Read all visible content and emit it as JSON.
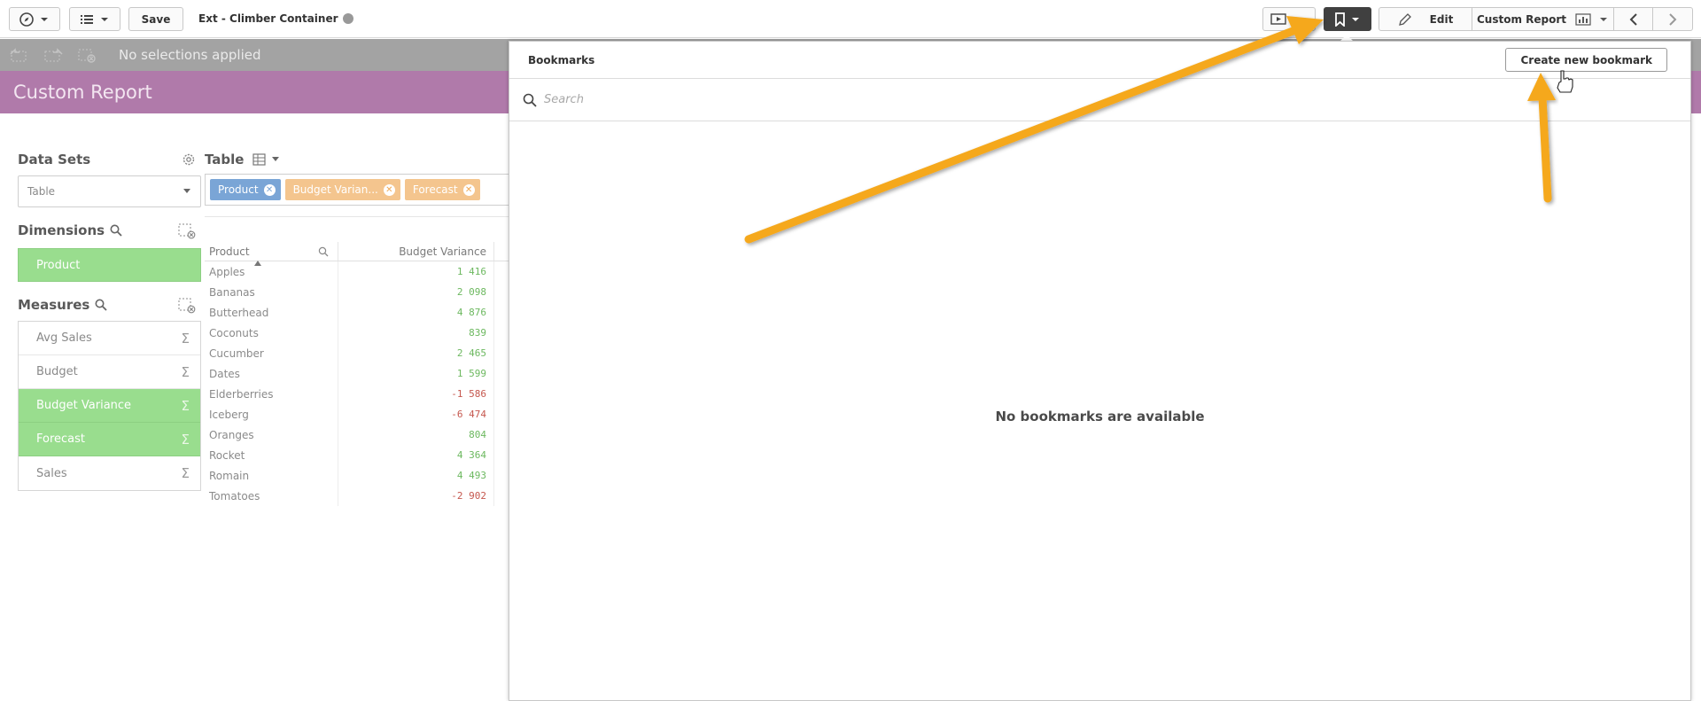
{
  "toolbar": {
    "save_label": "Save",
    "app_title": "Ext - Climber Container",
    "edit_label": "Edit",
    "sheet_label": "Custom Report"
  },
  "selections": {
    "status": "No selections applied"
  },
  "sheet": {
    "title": "Custom Report"
  },
  "left_panel": {
    "data_sets_label": "Data Sets",
    "data_set_selected": "Table",
    "dimensions_label": "Dimensions",
    "dimensions": [
      "Product"
    ],
    "measures_label": "Measures",
    "measures": [
      {
        "label": "Avg Sales",
        "selected": false
      },
      {
        "label": "Budget",
        "selected": false
      },
      {
        "label": "Budget Variance",
        "selected": true
      },
      {
        "label": "Forecast",
        "selected": true
      },
      {
        "label": "Sales",
        "selected": false
      }
    ],
    "sigma": "Σ"
  },
  "table_panel": {
    "title": "Table",
    "chips": [
      {
        "label": "Product",
        "color": "#7aa5d6"
      },
      {
        "label": "Budget Varian...",
        "color": "#f4c58e"
      },
      {
        "label": "Forecast",
        "color": "#f4c58e"
      }
    ],
    "columns": [
      "Product",
      "Budget Variance"
    ],
    "rows": [
      {
        "product": "Apples",
        "value": "1 416",
        "negative": false
      },
      {
        "product": "Bananas",
        "value": "2 098",
        "negative": false
      },
      {
        "product": "Butterhead",
        "value": "4 876",
        "negative": false
      },
      {
        "product": "Coconuts",
        "value": "839",
        "negative": false
      },
      {
        "product": "Cucumber",
        "value": "2 465",
        "negative": false
      },
      {
        "product": "Dates",
        "value": "1 599",
        "negative": false
      },
      {
        "product": "Elderberries",
        "value": "-1 586",
        "negative": true
      },
      {
        "product": "Iceberg",
        "value": "-6 474",
        "negative": true
      },
      {
        "product": "Oranges",
        "value": "804",
        "negative": false
      },
      {
        "product": "Rocket",
        "value": "4 364",
        "negative": false
      },
      {
        "product": "Romain",
        "value": "4 493",
        "negative": false
      },
      {
        "product": "Tomatoes",
        "value": "-2 902",
        "negative": true
      }
    ]
  },
  "bookmarks": {
    "title": "Bookmarks",
    "create_label": "Create new bookmark",
    "search_placeholder": "Search",
    "empty_message": "No bookmarks are available"
  },
  "colors": {
    "sheet_header": "#b07aaa",
    "selected_green": "#99dd8e",
    "arrow": "#f5a81c",
    "bookmark_active": "#404040"
  }
}
